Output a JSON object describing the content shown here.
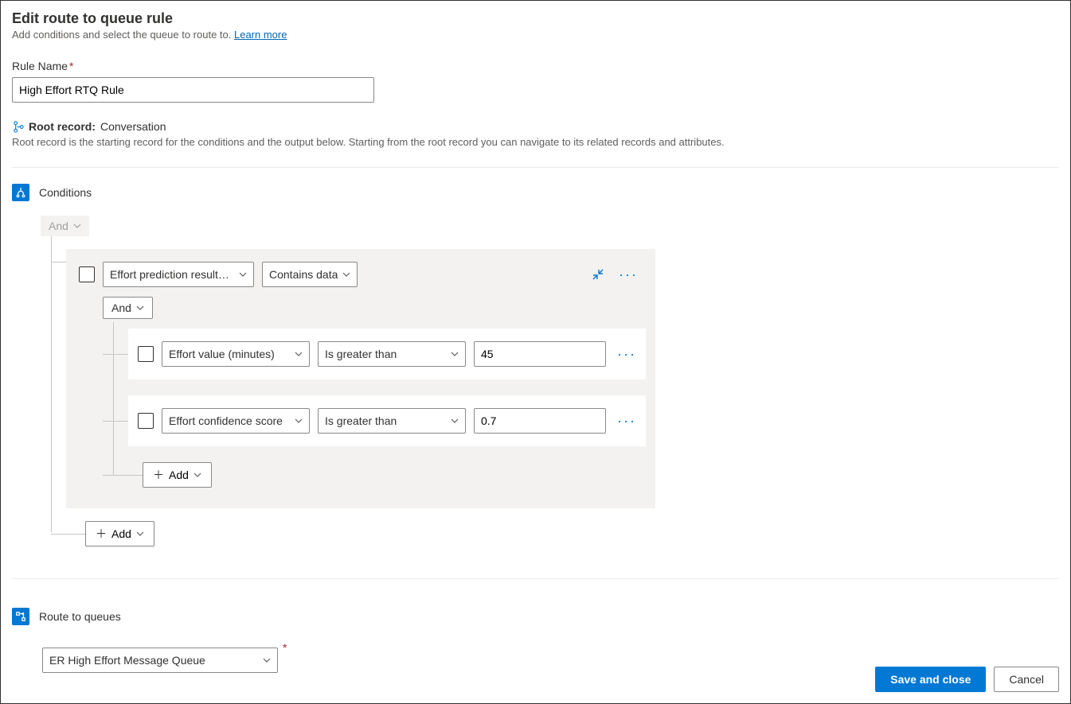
{
  "header": {
    "title": "Edit route to queue rule",
    "subtitle_prefix": "Add conditions and select the queue to route to. ",
    "learn_more": "Learn more"
  },
  "rule_name": {
    "label": "Rule Name",
    "value": "High Effort RTQ Rule"
  },
  "root_record": {
    "label": "Root record:",
    "value": "Conversation",
    "description": "Root record is the starting record for the conditions and the output below. Starting from the root record you can navigate to its related records and attributes."
  },
  "conditions": {
    "section_title": "Conditions",
    "outer_operator": "And",
    "group": {
      "field": "Effort prediction result…",
      "operator": "Contains data",
      "inner_operator": "And",
      "rows": [
        {
          "field": "Effort value (minutes)",
          "operator": "Is greater than",
          "value": "45"
        },
        {
          "field": "Effort confidence score",
          "operator": "Is greater than",
          "value": "0.7"
        }
      ],
      "add_label": "Add"
    },
    "add_label": "Add"
  },
  "route": {
    "section_title": "Route to queues",
    "selected_queue": "ER High Effort Message Queue"
  },
  "footer": {
    "save_label": "Save and close",
    "cancel_label": "Cancel"
  }
}
